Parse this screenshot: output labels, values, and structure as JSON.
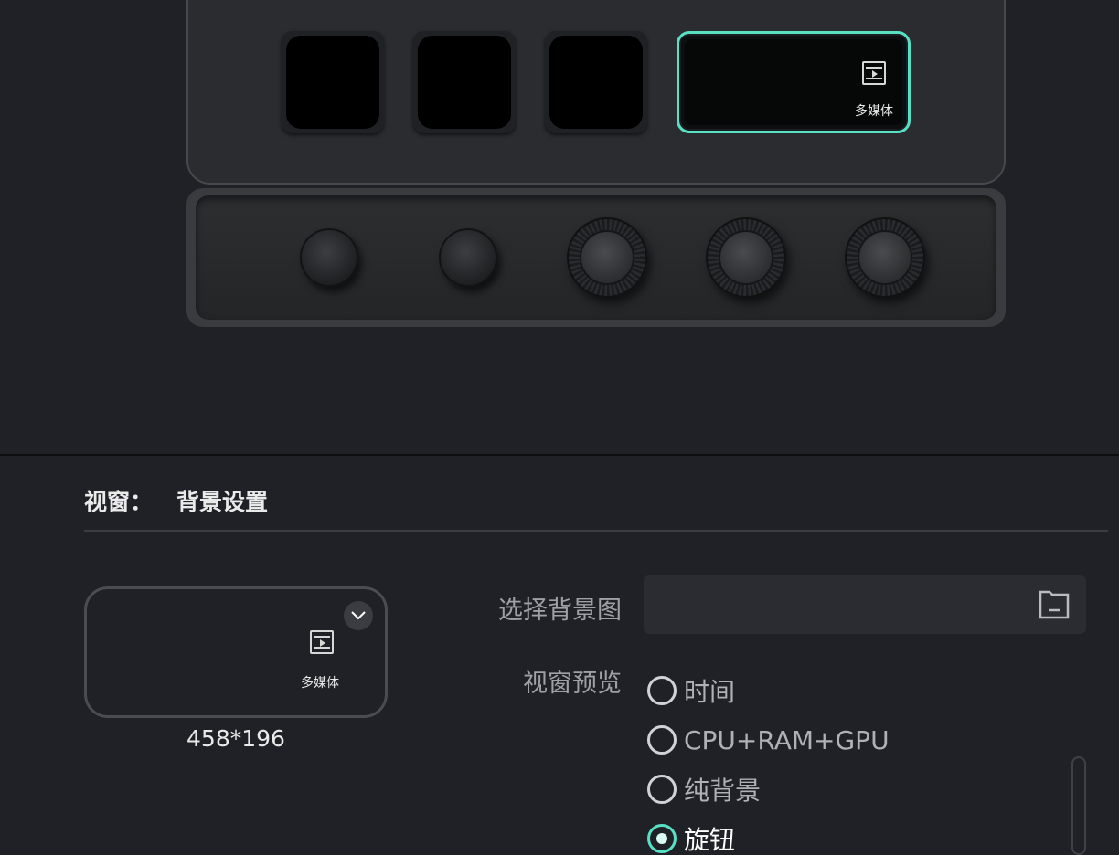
{
  "device": {
    "wide_key": {
      "icon": "multimedia-icon",
      "label": "多媒体",
      "highlight_color": "#58e0c4"
    },
    "buttons": 2,
    "dials": 3
  },
  "panel": {
    "title_prefix": "视窗：",
    "title": "背景设置",
    "preview": {
      "icon": "multimedia-icon",
      "label": "多媒体",
      "size": "458*196"
    },
    "bg_image": {
      "label": "选择背景图",
      "value": ""
    },
    "preview_mode": {
      "label": "视窗预览",
      "options": [
        "时间",
        "CPU+RAM+GPU",
        "纯背景",
        "旋钮"
      ],
      "selected": "旋钮"
    }
  },
  "colors": {
    "accent": "#58e0c4",
    "background": "#1f2126"
  }
}
